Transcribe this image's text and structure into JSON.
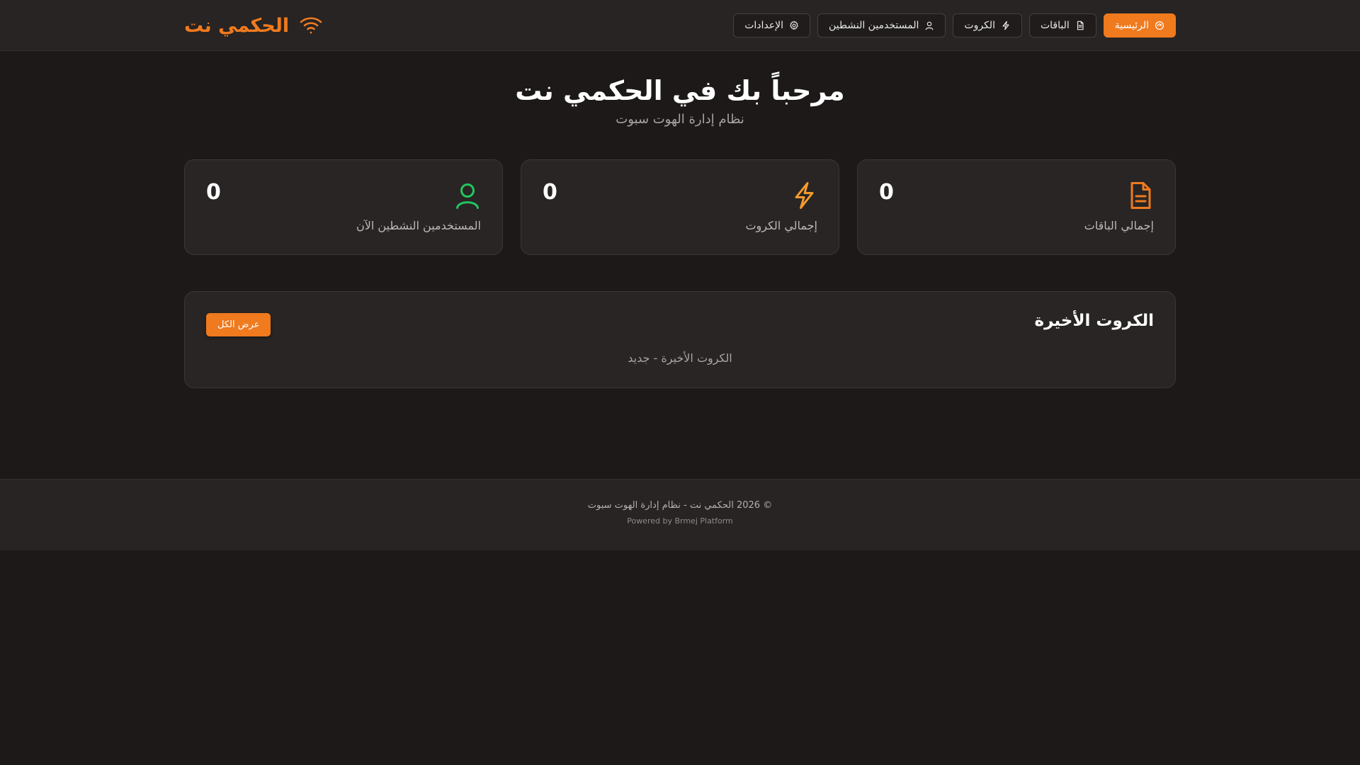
{
  "app": {
    "brand_name": "الحكمي نت",
    "brand_icon": "wifi-icon",
    "accent_color": "#f07a1e"
  },
  "nav": {
    "items": [
      {
        "label": "الرئيسية",
        "icon": "dashboard-icon",
        "active": true
      },
      {
        "label": "الباقات",
        "icon": "document-icon",
        "active": false
      },
      {
        "label": "الكروت",
        "icon": "lightning-icon",
        "active": false
      },
      {
        "label": "المستخدمين النشطين",
        "icon": "user-icon",
        "active": false
      },
      {
        "label": "الإعدادات",
        "icon": "gear-icon",
        "active": false
      }
    ]
  },
  "hero": {
    "title": "مرحباً بك في الحكمي نت",
    "subtitle": "نظام إدارة الهوت سبوت"
  },
  "stats": [
    {
      "label": "إجمالي الباقات",
      "value": "0",
      "icon": "document-icon",
      "color": "#f07a1e"
    },
    {
      "label": "إجمالي الكروت",
      "value": "0",
      "icon": "lightning-icon",
      "color": "#f49a2c"
    },
    {
      "label": "المستخدمين النشطين الآن",
      "value": "0",
      "icon": "user-icon",
      "color": "#22c55e"
    }
  ],
  "recent": {
    "title": "الكروت الأخيرة",
    "view_all_label": "عرض الكل",
    "empty_text": "الكروت الأخيرة - جديد"
  },
  "footer": {
    "copyright": "© 2026 الحكمي نت - نظام إدارة الهوت سبوت",
    "powered_by": "Powered by Brmej Platform"
  }
}
